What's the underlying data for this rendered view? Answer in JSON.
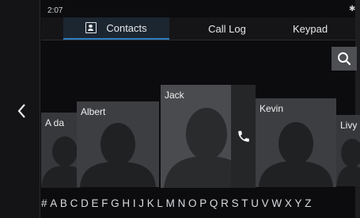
{
  "status": {
    "time": "2:07",
    "bluetooth_icon": "bluetooth-icon"
  },
  "tabs": [
    {
      "label": "Contacts",
      "icon": "contacts-icon",
      "active": true
    },
    {
      "label": "Call Log",
      "active": false
    },
    {
      "label": "Keypad",
      "active": false
    }
  ],
  "search": {
    "icon": "search-icon"
  },
  "navigation": {
    "back_icon": "chevron-left-icon"
  },
  "contacts": [
    {
      "name": "A da"
    },
    {
      "name": "Albert"
    },
    {
      "name": "Jack",
      "selected": true
    },
    {
      "name": "Kevin"
    },
    {
      "name": "Livy"
    }
  ],
  "call_action": {
    "icon": "phone-icon"
  },
  "alphabet_index": "#ABCDEFGHIJKLMNOPQRSTUVWXYZ",
  "colors": {
    "accent": "#2d7fc1",
    "background": "#0c0c0e",
    "card": "#3d3e41"
  }
}
